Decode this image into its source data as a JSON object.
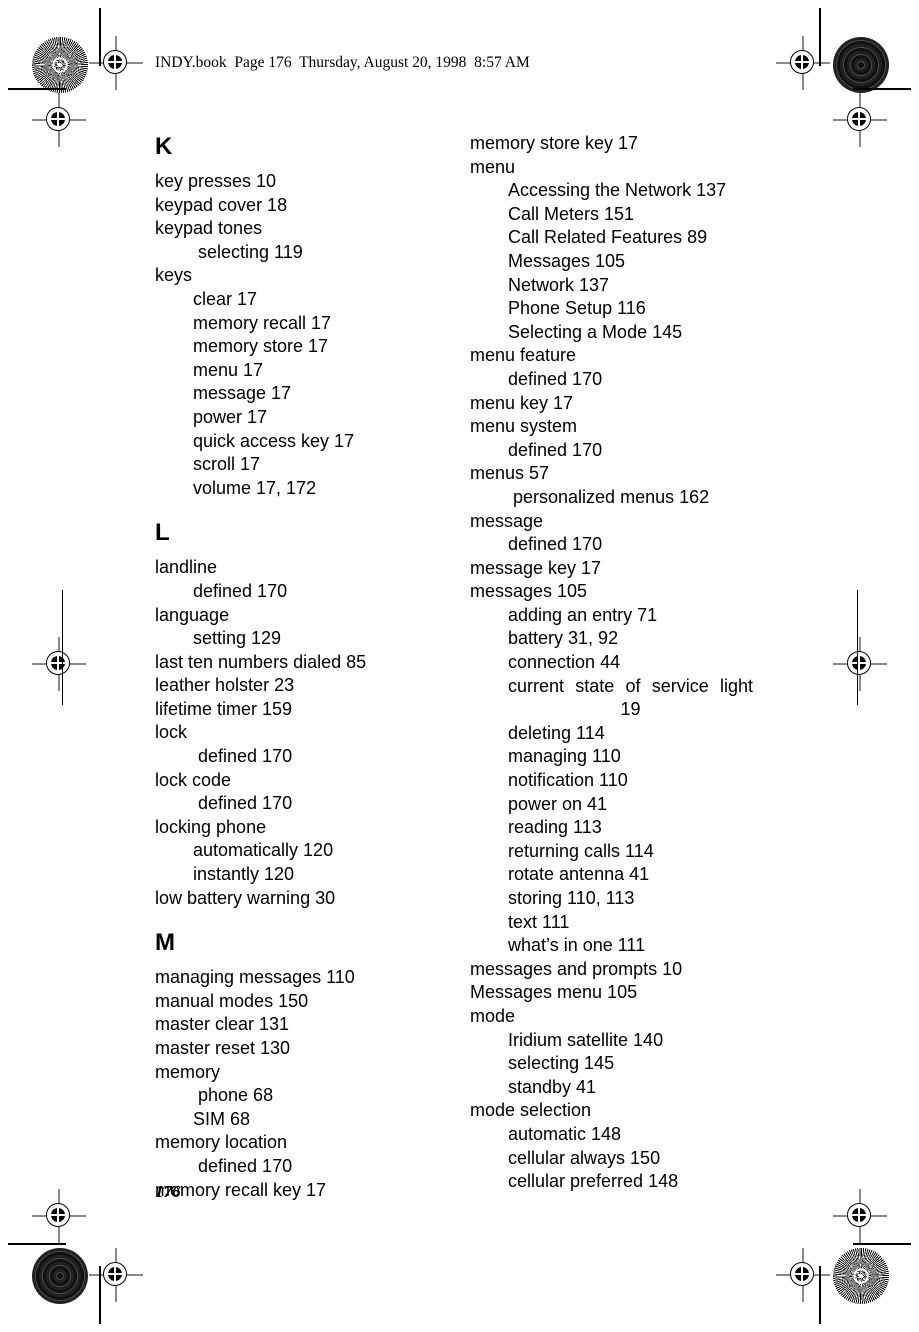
{
  "header": {
    "text": "INDY.book  Page 176  Thursday, August 20, 1998  8:57 AM"
  },
  "footer": {
    "page_number": "176"
  },
  "colors": {
    "ink": "#000000",
    "paper": "#ffffff",
    "registration_mark": "#8a8a8a"
  },
  "index": {
    "left_column": [
      {
        "kind": "letter",
        "text": "K"
      },
      {
        "kind": "entry",
        "level": 0,
        "text": "key presses 10"
      },
      {
        "kind": "entry",
        "level": 0,
        "text": "keypad cover 18"
      },
      {
        "kind": "entry",
        "level": 0,
        "text": "keypad tones"
      },
      {
        "kind": "entry",
        "level": 2,
        "text": "selecting 119"
      },
      {
        "kind": "entry",
        "level": 0,
        "text": "keys"
      },
      {
        "kind": "entry",
        "level": 1,
        "text": "clear 17"
      },
      {
        "kind": "entry",
        "level": 1,
        "text": "memory recall 17"
      },
      {
        "kind": "entry",
        "level": 1,
        "text": "memory store 17"
      },
      {
        "kind": "entry",
        "level": 1,
        "text": "menu 17"
      },
      {
        "kind": "entry",
        "level": 1,
        "text": "message 17"
      },
      {
        "kind": "entry",
        "level": 1,
        "text": "power 17"
      },
      {
        "kind": "entry",
        "level": 1,
        "text": "quick access key 17"
      },
      {
        "kind": "entry",
        "level": 1,
        "text": "scroll 17"
      },
      {
        "kind": "entry",
        "level": 1,
        "text": "volume 17, 172"
      },
      {
        "kind": "letter",
        "text": "L"
      },
      {
        "kind": "entry",
        "level": 0,
        "text": "landline"
      },
      {
        "kind": "entry",
        "level": 1,
        "text": "defined 170"
      },
      {
        "kind": "entry",
        "level": 0,
        "text": "language"
      },
      {
        "kind": "entry",
        "level": 1,
        "text": "setting 129"
      },
      {
        "kind": "entry",
        "level": 0,
        "text": "last ten numbers dialed 85"
      },
      {
        "kind": "entry",
        "level": 0,
        "text": "leather holster 23"
      },
      {
        "kind": "entry",
        "level": 0,
        "text": "lifetime timer 159"
      },
      {
        "kind": "entry",
        "level": 0,
        "text": "lock"
      },
      {
        "kind": "entry",
        "level": 2,
        "text": "defined 170"
      },
      {
        "kind": "entry",
        "level": 0,
        "text": "lock code"
      },
      {
        "kind": "entry",
        "level": 2,
        "text": "defined 170"
      },
      {
        "kind": "entry",
        "level": 0,
        "text": "locking phone"
      },
      {
        "kind": "entry",
        "level": 1,
        "text": "automatically 120"
      },
      {
        "kind": "entry",
        "level": 1,
        "text": "instantly 120"
      },
      {
        "kind": "entry",
        "level": 0,
        "text": "low battery warning 30"
      },
      {
        "kind": "letter",
        "text": "M"
      },
      {
        "kind": "entry",
        "level": 0,
        "text": "managing messages 110"
      },
      {
        "kind": "entry",
        "level": 0,
        "text": "manual modes 150"
      },
      {
        "kind": "entry",
        "level": 0,
        "text": "master clear 131"
      },
      {
        "kind": "entry",
        "level": 0,
        "text": "master reset 130"
      },
      {
        "kind": "entry",
        "level": 0,
        "text": "memory"
      },
      {
        "kind": "entry",
        "level": 2,
        "text": "phone 68"
      },
      {
        "kind": "entry",
        "level": 1,
        "text": "SIM 68"
      },
      {
        "kind": "entry",
        "level": 0,
        "text": "memory location"
      },
      {
        "kind": "entry",
        "level": 2,
        "text": "defined 170"
      },
      {
        "kind": "entry",
        "level": 0,
        "text": "memory recall key 17"
      }
    ],
    "right_column": [
      {
        "kind": "entry",
        "level": 0,
        "text": "memory store key 17"
      },
      {
        "kind": "entry",
        "level": 0,
        "text": "menu"
      },
      {
        "kind": "entry",
        "level": 1,
        "text": "Accessing the Network 137"
      },
      {
        "kind": "entry",
        "level": 1,
        "text": "Call Meters 151"
      },
      {
        "kind": "entry",
        "level": 1,
        "text": "Call Related Features 89"
      },
      {
        "kind": "entry",
        "level": 1,
        "text": "Messages 105"
      },
      {
        "kind": "entry",
        "level": 1,
        "text": "Network 137"
      },
      {
        "kind": "entry",
        "level": 1,
        "text": "Phone Setup 116"
      },
      {
        "kind": "entry",
        "level": 1,
        "text": "Selecting a Mode 145"
      },
      {
        "kind": "entry",
        "level": 0,
        "text": "menu feature"
      },
      {
        "kind": "entry",
        "level": 1,
        "text": "defined 170"
      },
      {
        "kind": "entry",
        "level": 0,
        "text": "menu key 17"
      },
      {
        "kind": "entry",
        "level": 0,
        "text": "menu system"
      },
      {
        "kind": "entry",
        "level": 1,
        "text": "defined 170"
      },
      {
        "kind": "entry",
        "level": 0,
        "text": "menus 57"
      },
      {
        "kind": "entry",
        "level": 2,
        "text": "personalized menus 162"
      },
      {
        "kind": "entry",
        "level": 0,
        "text": "message"
      },
      {
        "kind": "entry",
        "level": 1,
        "text": "defined 170"
      },
      {
        "kind": "entry",
        "level": 0,
        "text": "message key 17"
      },
      {
        "kind": "entry",
        "level": 0,
        "text": "messages 105"
      },
      {
        "kind": "entry",
        "level": 1,
        "text": "adding an entry 71"
      },
      {
        "kind": "entry",
        "level": 1,
        "text": "battery 31, 92"
      },
      {
        "kind": "entry",
        "level": 1,
        "text": "connection 44"
      },
      {
        "kind": "entry",
        "level": 1,
        "justified": true,
        "text": "current state of service light 19"
      },
      {
        "kind": "entry",
        "level": 1,
        "text": "deleting 114"
      },
      {
        "kind": "entry",
        "level": 1,
        "text": "managing 110"
      },
      {
        "kind": "entry",
        "level": 1,
        "text": "notification 110"
      },
      {
        "kind": "entry",
        "level": 1,
        "text": "power on 41"
      },
      {
        "kind": "entry",
        "level": 1,
        "text": "reading 113"
      },
      {
        "kind": "entry",
        "level": 1,
        "text": "returning calls 114"
      },
      {
        "kind": "entry",
        "level": 1,
        "text": "rotate antenna 41"
      },
      {
        "kind": "entry",
        "level": 1,
        "text": "storing 110, 113"
      },
      {
        "kind": "entry",
        "level": 1,
        "text": "text 111"
      },
      {
        "kind": "entry",
        "level": 1,
        "text": "what’s in one 111"
      },
      {
        "kind": "entry",
        "level": 0,
        "text": "messages and prompts 10"
      },
      {
        "kind": "entry",
        "level": 0,
        "text": "Messages menu 105"
      },
      {
        "kind": "entry",
        "level": 0,
        "text": "mode"
      },
      {
        "kind": "entry",
        "level": 1,
        "text": "Iridium satellite 140"
      },
      {
        "kind": "entry",
        "level": 1,
        "text": "selecting 145"
      },
      {
        "kind": "entry",
        "level": 1,
        "text": "standby 41"
      },
      {
        "kind": "entry",
        "level": 0,
        "text": "mode selection"
      },
      {
        "kind": "entry",
        "level": 1,
        "text": "automatic 148"
      },
      {
        "kind": "entry",
        "level": 1,
        "text": "cellular always 150"
      },
      {
        "kind": "entry",
        "level": 1,
        "text": "cellular preferred 148"
      }
    ]
  }
}
